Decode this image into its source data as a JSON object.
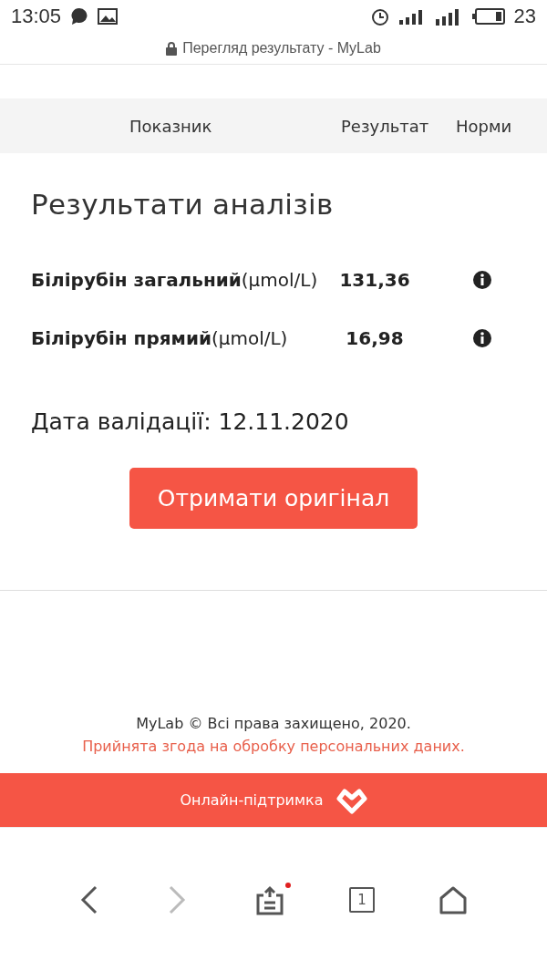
{
  "status_bar": {
    "time": "13:05",
    "battery": "23"
  },
  "address_bar": {
    "title": "Перегляд результату - MyLab"
  },
  "table_header": {
    "columns": [
      "Показник",
      "Результат",
      "Норми"
    ]
  },
  "title": "Результати аналізів",
  "results": [
    {
      "name": "**Білірубін загальний**(μmol/L)",
      "value": "131,36"
    },
    {
      "name": "**Білірубін прямий**(μmol/L)",
      "value": "16,98"
    }
  ],
  "validation_date": "Дата валідації: 12.11.2020",
  "original_button": "Отримати оригінал",
  "footer": {
    "copyright": "MyLab © Всі права захищено, 2020.",
    "consent": "Прийнята згода на обробку персональних даних."
  },
  "support_bar": {
    "label": "Онлайн-підтримка"
  },
  "browser_nav": {
    "back_disabled": false,
    "forward_disabled": true,
    "share_badge": true,
    "tabs_count": "1"
  }
}
